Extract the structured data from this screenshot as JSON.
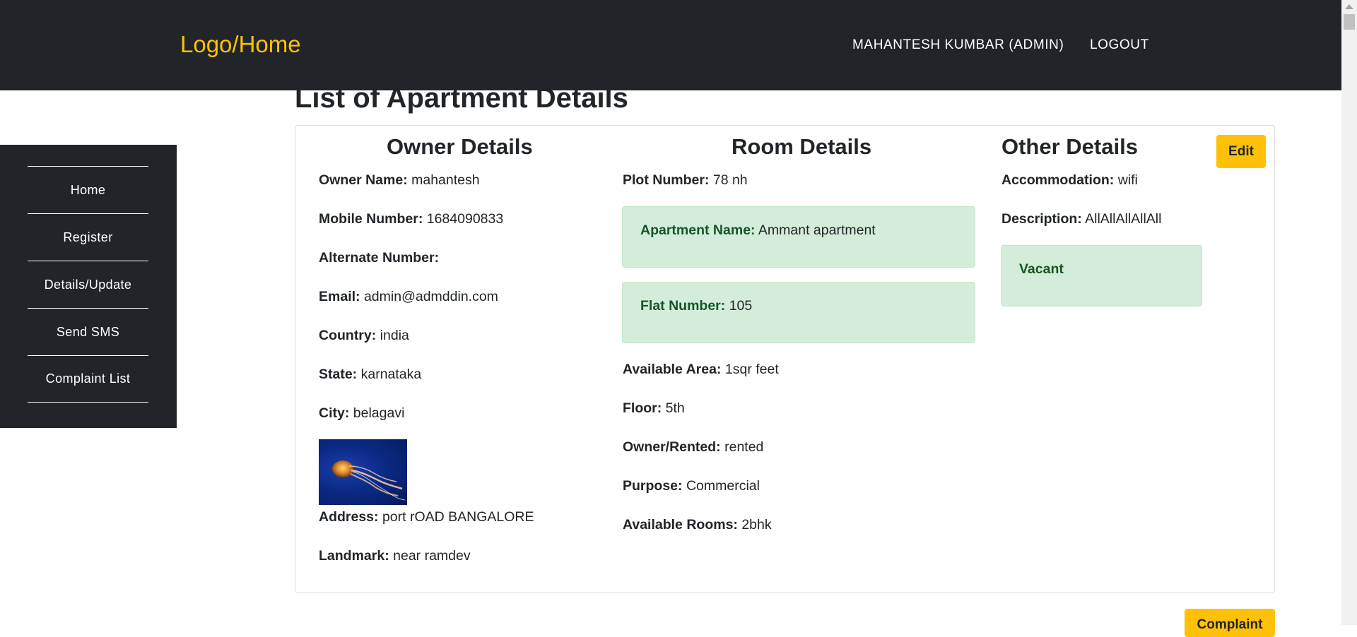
{
  "navbar": {
    "brand": "Logo/Home",
    "user": "MAHANTESH KUMBAR (ADMIN)",
    "logout": "LOGOUT"
  },
  "sidebar": {
    "items": [
      {
        "label": "Home"
      },
      {
        "label": "Register"
      },
      {
        "label": "Details/Update"
      },
      {
        "label": "Send SMS"
      },
      {
        "label": "Complaint List"
      }
    ]
  },
  "page": {
    "title": "List of Apartment Details"
  },
  "owner": {
    "heading": "Owner Details",
    "name_label": "Owner Name:",
    "name": "mahantesh",
    "mobile_label": "Mobile Number:",
    "mobile": "1684090833",
    "alt_label": "Alternate Number:",
    "alt": "",
    "email_label": "Email:",
    "email": "admin@admddin.com",
    "country_label": "Country:",
    "country": "india",
    "state_label": "State:",
    "state": "karnataka",
    "city_label": "City:",
    "city": "belagavi",
    "address_label": "Address:",
    "address": "port rOAD BANGALORE",
    "landmark_label": "Landmark:",
    "landmark": "near ramdev"
  },
  "room": {
    "heading": "Room Details",
    "plot_label": "Plot Number:",
    "plot": "78 nh",
    "apartment_label": "Apartment Name:",
    "apartment": "Ammant apartment",
    "flat_label": "Flat Number:",
    "flat": "105",
    "area_label": "Available Area:",
    "area": "1sqr feet",
    "floor_label": "Floor:",
    "floor": "5th",
    "owner_rented_label": "Owner/Rented:",
    "owner_rented": "rented",
    "purpose_label": "Purpose:",
    "purpose": "Commercial",
    "rooms_label": "Available Rooms:",
    "rooms": "2bhk"
  },
  "other": {
    "heading": "Other Details",
    "accommodation_label": "Accommodation:",
    "accommodation": "wifi",
    "description_label": "Description:",
    "description": "AllAllAllAllAll",
    "status": "Vacant"
  },
  "buttons": {
    "edit": "Edit",
    "complaint": "Complaint"
  },
  "colors": {
    "navbar_bg": "#212529",
    "brand": "#ffc107",
    "accent_button": "#ffc107",
    "alert_bg": "#d4edda",
    "alert_text": "#155724"
  }
}
